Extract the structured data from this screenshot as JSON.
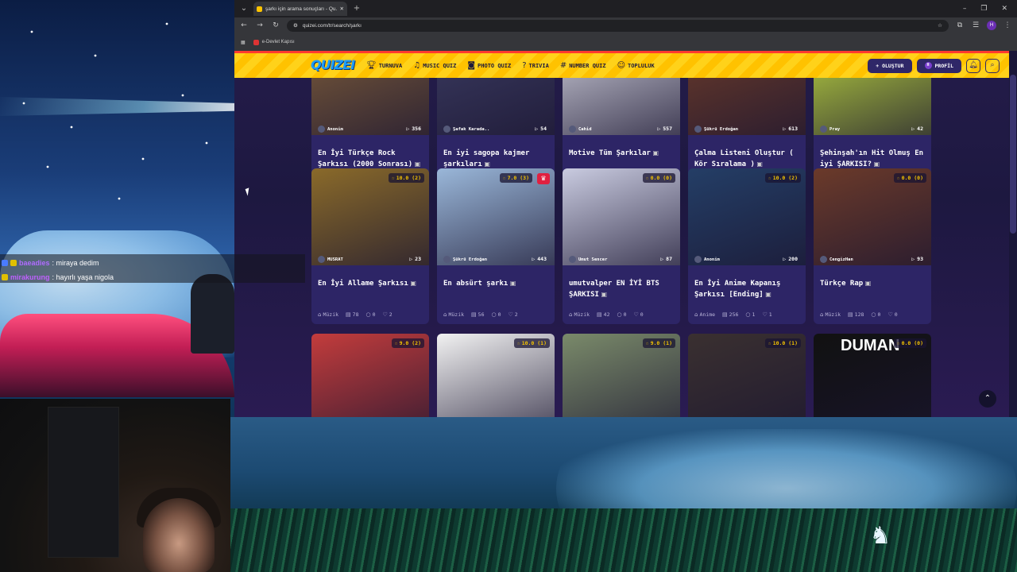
{
  "browser": {
    "tab_title": "şarkı için arama sonuçları - Qu...",
    "url": "quizei.com/tr/search/şarkı",
    "bookmark": "e-Devlet Kapısı",
    "profile_initial": "H"
  },
  "site": {
    "logo": "QUIZEI",
    "nav": [
      {
        "label": "TURNUVA",
        "icon": "trophy-icon"
      },
      {
        "label": "MUSIC QUIZ",
        "icon": "music-icon"
      },
      {
        "label": "PHOTO QUIZ",
        "icon": "camera-icon"
      },
      {
        "label": "TRIVIA",
        "icon": "question-icon"
      },
      {
        "label": "NUMBER QUIZ",
        "icon": "hash-icon"
      },
      {
        "label": "TOPLULUK",
        "icon": "people-icon"
      }
    ],
    "create_label": "+ OLUŞTUR",
    "profile_label": "PROFİL",
    "profile_avatar": "H"
  },
  "chat": [
    {
      "user": "baeadies",
      "message": ": miraya dedim",
      "color": "#b06cff"
    },
    {
      "user": "mirakurung",
      "message": ": hayırlı yaşa nigola",
      "color": "#c060ff"
    }
  ],
  "cards_row1": [
    {
      "author": "Anonim",
      "plays": "356",
      "title": "En İyi Türkçe Rock Şarkısı (2000 Sonrası)",
      "category": "Müzik",
      "questions": "256",
      "comments": "0",
      "likes": "3"
    },
    {
      "author": "Şafak Karada..",
      "plays": "54",
      "title": "En iyi sagopa kajmer şarkıları",
      "category": "Müzik",
      "questions": "68",
      "comments": "0",
      "likes": "0"
    },
    {
      "author": "Cahid",
      "plays": "557",
      "title": "Motive Tüm Şarkılar",
      "category": "Müzik",
      "questions": "167",
      "comments": "0",
      "likes": "0"
    },
    {
      "author": "Şükrü Erdoğan",
      "plays": "613",
      "title": "Çalma Listeni Oluştur ( Kör Sıralama )",
      "category": "Müzik",
      "questions": "256",
      "comments": "0",
      "likes": "0"
    },
    {
      "author": "Pray",
      "plays": "42",
      "title": "Şehinşah'ın Hit Olmuş En iyi ŞARKISI?",
      "category": "Müzik",
      "questions": "35",
      "comments": "0",
      "likes": "0"
    }
  ],
  "cards_row2": [
    {
      "rating": "10.0 (2)",
      "author": "MUSRAT",
      "plays": "23",
      "title": "En İyi Allame Şarkısı",
      "category": "Müzik",
      "questions": "78",
      "comments": "0",
      "likes": "2"
    },
    {
      "rating": "7.0 (3)",
      "author": "Şükrü Erdoğan",
      "plays": "443",
      "title": "En absürt şarkı",
      "category": "Müzik",
      "questions": "56",
      "comments": "0",
      "likes": "2"
    },
    {
      "rating": "0.0 (0)",
      "author": "Umut Sencer",
      "plays": "87",
      "title": "umutvalper EN İYİ BTS ŞARKISI",
      "category": "Müzik",
      "questions": "42",
      "comments": "0",
      "likes": "0"
    },
    {
      "rating": "10.0 (2)",
      "author": "Anonim",
      "plays": "200",
      "title": "En İyi Anime Kapanış Şarkısı [Ending]",
      "category": "Anime",
      "questions": "256",
      "comments": "1",
      "likes": "1"
    },
    {
      "rating": "0.0 (0)",
      "author": "CengizHan",
      "plays": "93",
      "title": "Türkçe Rap",
      "category": "Müzik",
      "questions": "128",
      "comments": "0",
      "likes": "0"
    }
  ],
  "cards_row3": [
    {
      "rating": "9.0 (2)"
    },
    {
      "rating": "10.0 (1)"
    },
    {
      "rating": "9.0 (1)"
    },
    {
      "rating": "10.0 (1)"
    },
    {
      "rating": "0.0 (0)",
      "image_text": "DUMAN"
    }
  ]
}
